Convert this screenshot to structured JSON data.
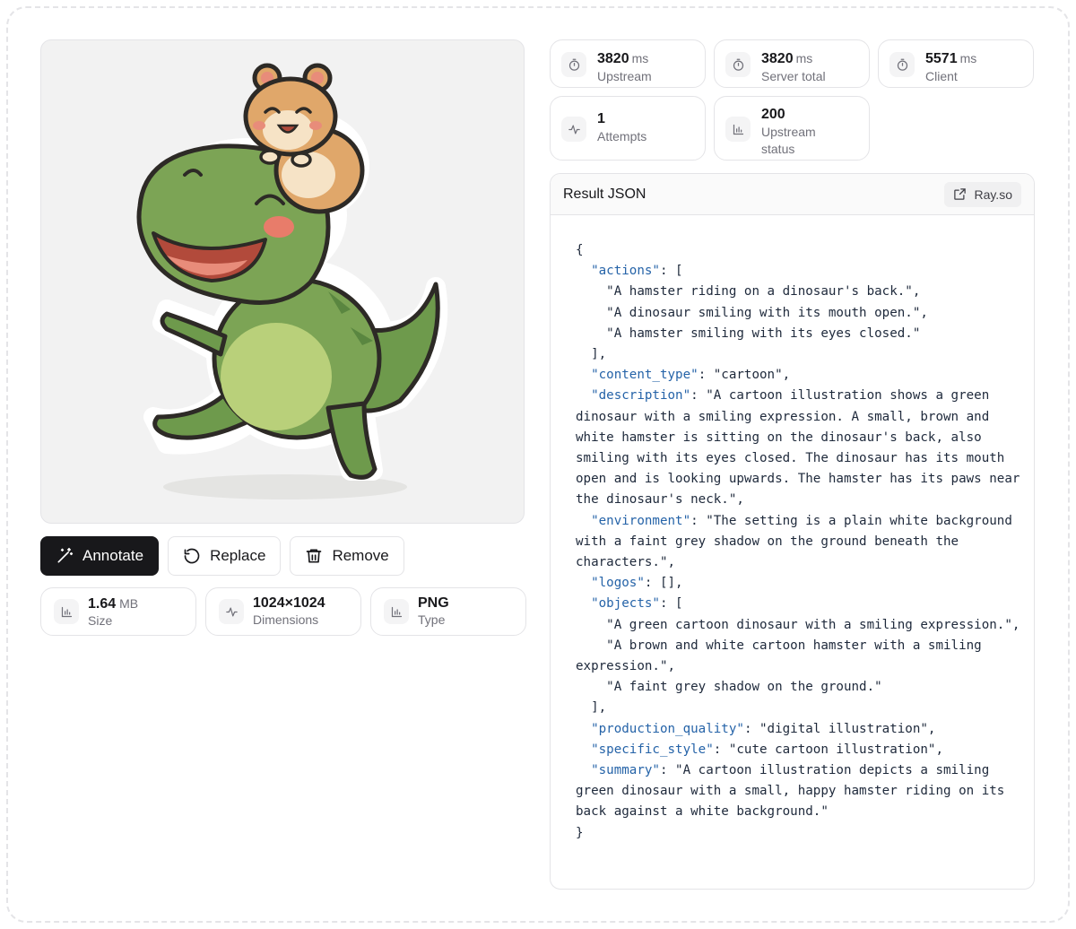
{
  "toolbar": {
    "annotate_label": "Annotate",
    "replace_label": "Replace",
    "remove_label": "Remove"
  },
  "image_meta": {
    "size_value": "1.64",
    "size_unit": "MB",
    "size_label": "Size",
    "dimensions_value": "1024×1024",
    "dimensions_label": "Dimensions",
    "type_value": "PNG",
    "type_label": "Type"
  },
  "stats": [
    {
      "value": "3820",
      "unit": "ms",
      "label": "Upstream",
      "icon": "stopwatch-icon"
    },
    {
      "value": "3820",
      "unit": "ms",
      "label": "Server total",
      "icon": "stopwatch-icon"
    },
    {
      "value": "5571",
      "unit": "ms",
      "label": "Client",
      "icon": "stopwatch-icon"
    },
    {
      "value": "1",
      "unit": "",
      "label": "Attempts",
      "icon": "activity-icon"
    },
    {
      "value": "200",
      "unit": "",
      "label": "Upstream status",
      "icon": "bar-chart-icon"
    }
  ],
  "result": {
    "title": "Result JSON",
    "rayso_label": "Ray.so",
    "json": {
      "actions": [
        "A hamster riding on a dinosaur's back.",
        "A dinosaur smiling with its mouth open.",
        "A hamster smiling with its eyes closed."
      ],
      "content_type": "cartoon",
      "description": "A cartoon illustration shows a green dinosaur with a smiling expression. A small, brown and white hamster is sitting on the dinosaur's back, also smiling with its eyes closed. The dinosaur has its mouth open and is looking upwards. The hamster has its paws near the dinosaur's neck.",
      "environment": "The setting is a plain white background with a faint grey shadow on the ground beneath the characters.",
      "logos": [],
      "objects": [
        "A green cartoon dinosaur with a smiling expression.",
        "A brown and white cartoon hamster with a smiling expression.",
        "A faint grey shadow on the ground."
      ],
      "production_quality": "digital illustration",
      "specific_style": "cute cartoon illustration",
      "summary": "A cartoon illustration depicts a smiling green dinosaur with a small, happy hamster riding on its back against a white background."
    }
  }
}
